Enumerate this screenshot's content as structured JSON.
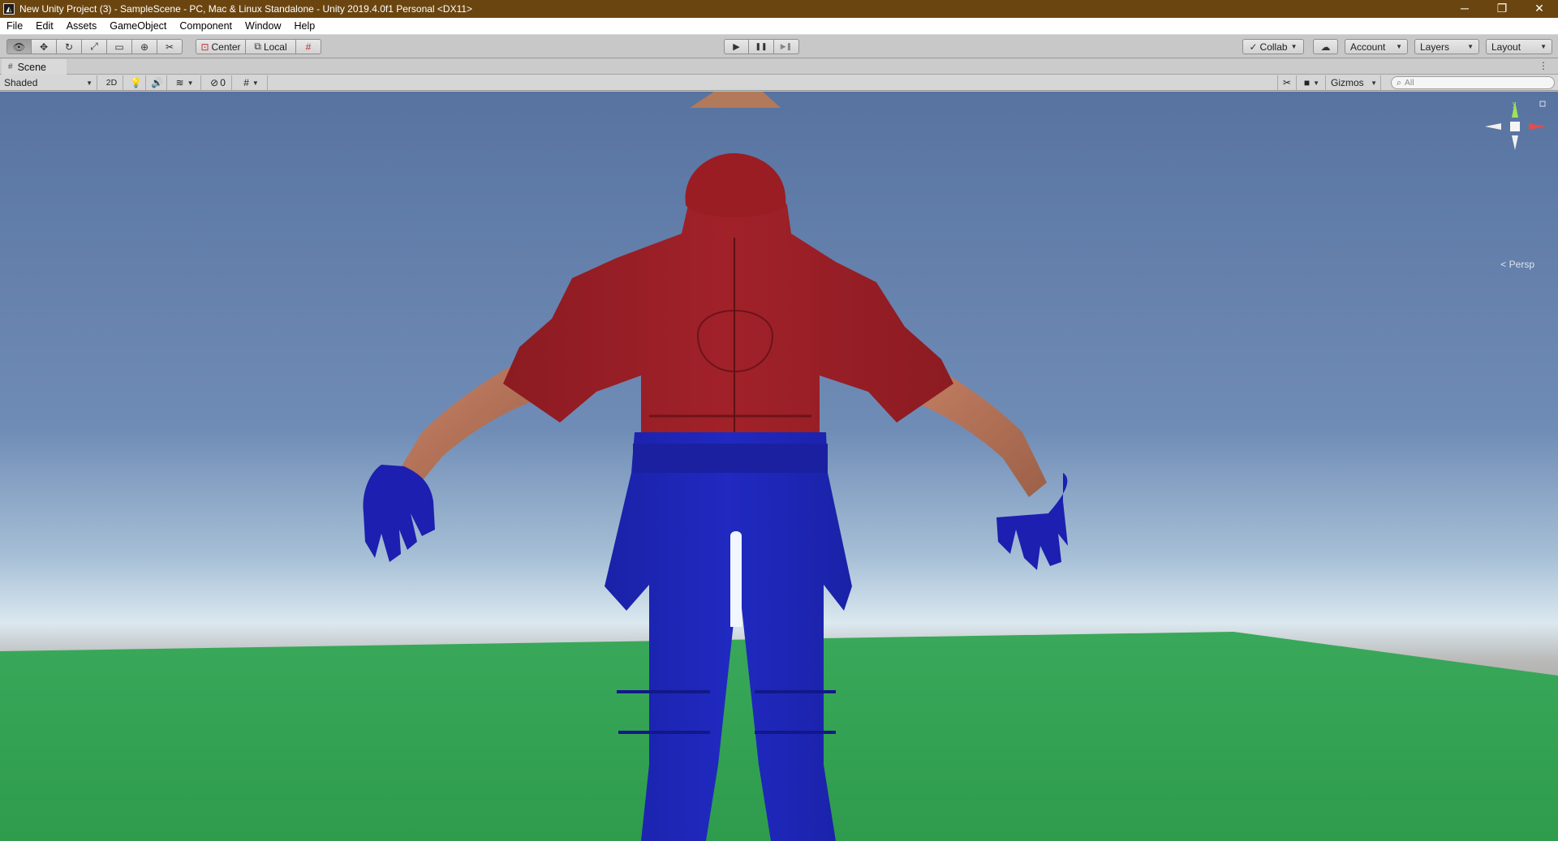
{
  "window": {
    "title": "New Unity Project (3) - SampleScene - PC, Mac & Linux Standalone - Unity 2019.4.0f1 Personal <DX11>",
    "icon": "unity-icon",
    "controls": [
      "─",
      "❐",
      "✕"
    ]
  },
  "menu": [
    "File",
    "Edit",
    "Assets",
    "GameObject",
    "Component",
    "Window",
    "Help"
  ],
  "toolbar": {
    "tools": [
      {
        "name": "hand-tool",
        "icon": "👁"
      },
      {
        "name": "move-tool",
        "icon": "✥"
      },
      {
        "name": "rotate-tool",
        "icon": "↻"
      },
      {
        "name": "scale-tool",
        "icon": "⤢"
      },
      {
        "name": "rect-tool",
        "icon": "▭"
      },
      {
        "name": "transform-tool",
        "icon": "⊕"
      },
      {
        "name": "custom-tool",
        "icon": "✂"
      }
    ],
    "pivot_mode": "Center",
    "pivot_rotation": "Local",
    "play_controls": [
      "▶",
      "❚❚",
      "▶❚"
    ],
    "collab": "Collab",
    "account": "Account",
    "layers": "Layers",
    "layout": "Layout"
  },
  "scene_tab": {
    "label": "Scene"
  },
  "scene_toolbar": {
    "shading_mode": "Shaded",
    "toggle_2d": "2D",
    "hidden_count": "0",
    "gizmos": "Gizmos",
    "search_placeholder": "All"
  },
  "viewport": {
    "projection": "< Persp",
    "gizmo_axes": [
      "y",
      "x"
    ],
    "colors": {
      "sky_top": "#5873a0",
      "sky_horizon": "#d8e6ee",
      "ground_far": "#6e6864",
      "grass": "#35a656",
      "shirt": "#9a1d24",
      "pants": "#1d24b4",
      "skin": "#bd7a5c"
    }
  }
}
